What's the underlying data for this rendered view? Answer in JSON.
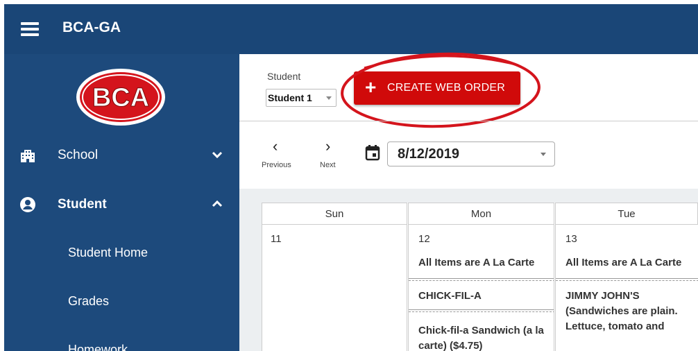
{
  "app": {
    "title": "BCA-GA",
    "logo_text": "BCA"
  },
  "sidebar": {
    "items": [
      {
        "label": "School",
        "icon": "building-icon",
        "expanded": false
      },
      {
        "label": "Student",
        "icon": "account-circle-icon",
        "expanded": true
      }
    ],
    "student_subitems": [
      "Student Home",
      "Grades",
      "Homework"
    ]
  },
  "toolbar": {
    "student_label": "Student",
    "student_value": "Student 1",
    "create_button_label": "CREATE WEB ORDER"
  },
  "date_nav": {
    "previous_label": "Previous",
    "next_label": "Next",
    "date_value": "8/12/2019"
  },
  "calendar": {
    "days": [
      {
        "name": "Sun",
        "number": "11",
        "notice": "",
        "items": []
      },
      {
        "name": "Mon",
        "number": "12",
        "notice": "All Items are A La Carte",
        "items": [
          "CHICK-FIL-A",
          "Chick-fil-a Sandwich (a la carte) ($4.75)"
        ]
      },
      {
        "name": "Tue",
        "number": "13",
        "notice": "All Items are A La Carte",
        "items": [
          "JIMMY JOHN'S (Sandwiches are plain. Lettuce, tomato and"
        ]
      }
    ]
  },
  "colors": {
    "topbar": "#1a4677",
    "sidebar": "#1d4a7c",
    "create_button": "#d00a0a",
    "highlight_ring": "#d4141c"
  }
}
